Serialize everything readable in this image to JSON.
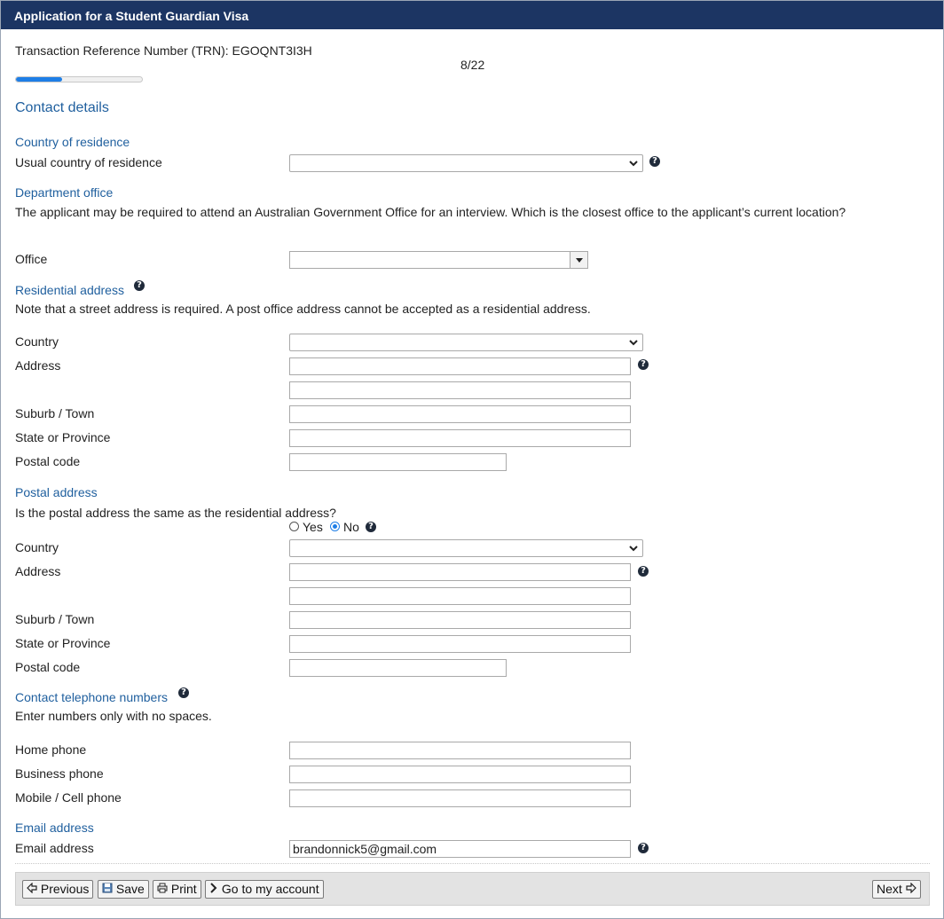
{
  "window": {
    "title": "Application for a Student Guardian Visa"
  },
  "trn": {
    "label": "Transaction Reference Number (TRN): EGOQNT3I3H"
  },
  "progress": {
    "text": "8/22",
    "fraction": 0.3636
  },
  "page_heading": "Contact details",
  "country_of_residence": {
    "section": "Country of residence",
    "label": "Usual country of residence",
    "value": ""
  },
  "department_office": {
    "section": "Department office",
    "note": "The applicant may be required to attend an Australian Government Office for an interview. Which is the closest office to the applicant’s current location?",
    "office_label": "Office",
    "office_value": ""
  },
  "residential": {
    "section": "Residential address",
    "note": "Note that a street address is required. A post office address cannot be accepted as a residential address.",
    "country_label": "Country",
    "address_label": "Address",
    "suburb_label": "Suburb / Town",
    "state_label": "State or Province",
    "postal_label": "Postal code",
    "country_value": "",
    "address1": "",
    "address2": "",
    "suburb": "",
    "state": "",
    "postal": ""
  },
  "postal": {
    "section": "Postal address",
    "question": "Is the postal address the same as the residential address?",
    "yes_label": "Yes",
    "no_label": "No",
    "selected": "No",
    "country_label": "Country",
    "address_label": "Address",
    "suburb_label": "Suburb / Town",
    "state_label": "State or Province",
    "postal_label": "Postal code",
    "country_value": "",
    "address1": "",
    "address2": "",
    "suburb": "",
    "state": "",
    "postal": ""
  },
  "phones": {
    "section": "Contact telephone numbers",
    "note": "Enter numbers only with no spaces.",
    "home_label": "Home phone",
    "business_label": "Business phone",
    "mobile_label": "Mobile / Cell phone",
    "home": "",
    "business": "",
    "mobile": ""
  },
  "email": {
    "section": "Email address",
    "label": "Email address",
    "value": "brandonnick5@gmail.com"
  },
  "footer": {
    "previous": "Previous",
    "save": "Save",
    "print": "Print",
    "account": "Go to my account",
    "next": "Next"
  },
  "icons": {
    "help": "help-icon",
    "previous": "arrow-left-icon",
    "save": "floppy-icon",
    "print": "printer-icon",
    "account": "chevron-right-icon",
    "next": "arrow-right-icon"
  },
  "colors": {
    "titlebar": "#1c3563",
    "section": "#1f5f9e",
    "progress": "#1e7ee6"
  }
}
